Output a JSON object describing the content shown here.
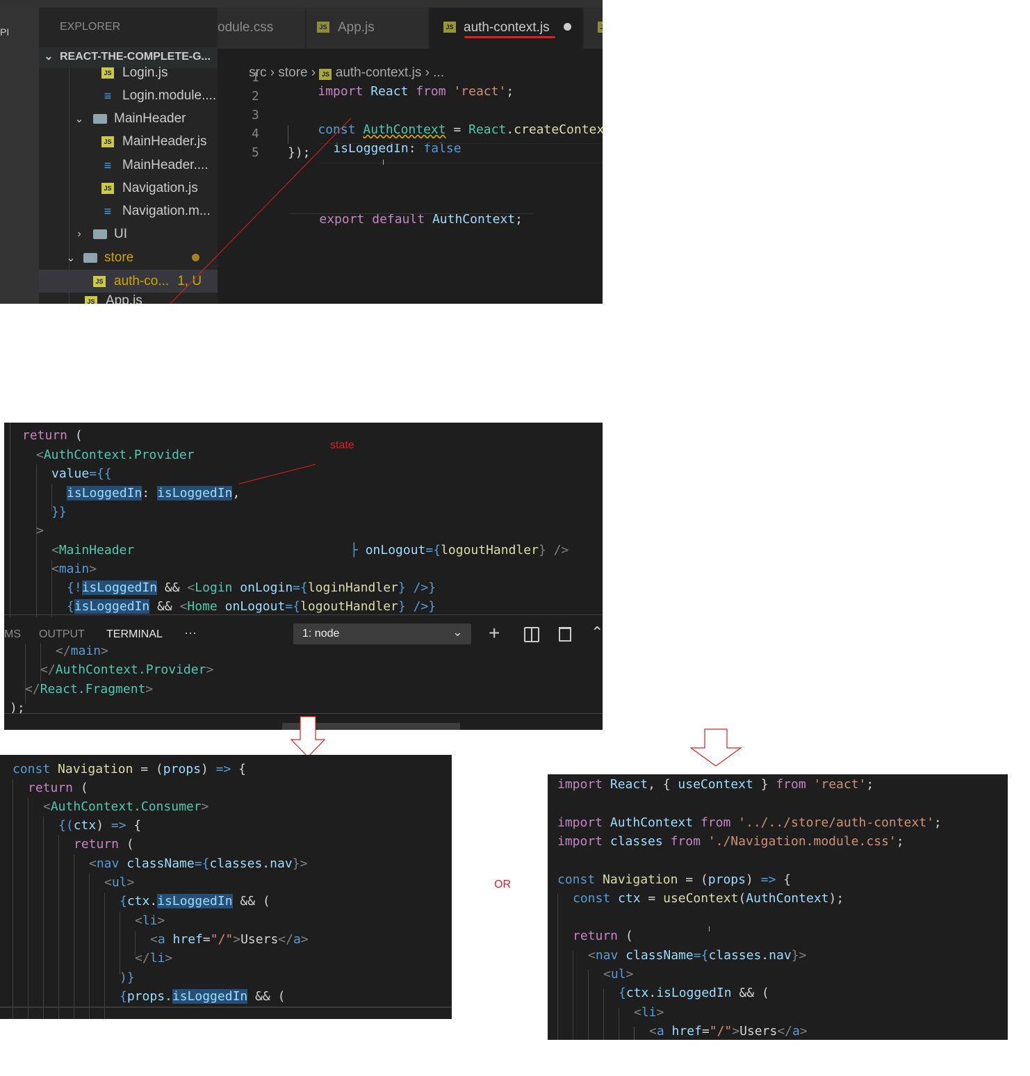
{
  "top": {
    "explorer_label": "EXPLORER",
    "left_edge_label": "PI",
    "tabs": [
      {
        "label": "odule.css"
      },
      {
        "label": "App.js",
        "icon": "JS"
      },
      {
        "label": "auth-context.js",
        "icon": "JS"
      }
    ],
    "project_name": "REACT-THE-COMPLETE-G...",
    "breadcrumb": [
      "src",
      "store",
      "auth-context.js",
      "..."
    ],
    "tree": [
      {
        "label": "Login.js",
        "type": "js"
      },
      {
        "label": "Login.module....",
        "type": "css"
      },
      {
        "label": "MainHeader",
        "type": "folder-open"
      },
      {
        "label": "MainHeader.js",
        "type": "js"
      },
      {
        "label": "MainHeader....",
        "type": "css"
      },
      {
        "label": "Navigation.js",
        "type": "js"
      },
      {
        "label": "Navigation.m...",
        "type": "css"
      },
      {
        "label": "UI",
        "type": "folder-closed"
      },
      {
        "label": "store",
        "type": "folder-open"
      },
      {
        "label": "auth-co...",
        "type": "js",
        "badge": "1, U"
      },
      {
        "label": "App.js",
        "type": "js"
      }
    ],
    "line_numbers": [
      "1",
      "2",
      "3",
      "4",
      "5"
    ],
    "code": {
      "l1": [
        "import",
        " React ",
        "from",
        " 'react'",
        ";"
      ],
      "l3": [
        "const",
        " ",
        "AuthContext",
        " = ",
        "React",
        ".",
        "createContext",
        "({"
      ],
      "l4": [
        "isLoggedIn",
        ": ",
        "false"
      ],
      "l5": "});",
      "export": [
        "export",
        " ",
        "default",
        " ",
        "AuthContext",
        ";"
      ]
    }
  },
  "mid": {
    "annotation": "state",
    "terminal_tabs": [
      "MS",
      "OUTPUT",
      "TERMINAL",
      "···"
    ],
    "terminal_select": "1: node",
    "lines": {
      "l1": [
        "return",
        " ("
      ],
      "l2": [
        "<",
        "AuthContext.Provider"
      ],
      "l3": [
        "value",
        "={{"
      ],
      "l4": [
        "isLoggedIn",
        ": ",
        "isLoggedIn",
        ","
      ],
      "l5": "}}",
      "l6": ">",
      "l7a": [
        "<",
        "MainHeader"
      ],
      "l7b": [
        "onLogout",
        "={",
        "logoutHandler",
        "} />"
      ],
      "l8": [
        "<",
        "main",
        ">"
      ],
      "l9": [
        "{!",
        "isLoggedIn",
        " && ",
        "<",
        "Login",
        " ",
        "onLogin",
        "={",
        "loginHandler",
        "} />}"
      ],
      "l10": [
        "{",
        "isLoggedIn",
        " && ",
        "<",
        "Home",
        " ",
        "onLogout",
        "={",
        "logoutHandler",
        "} />}"
      ],
      "l11": [
        "</",
        "main",
        ">"
      ],
      "l12": [
        "</",
        "AuthContext.Provider",
        ">"
      ],
      "l13": [
        "</",
        "React.Fragment",
        ">"
      ],
      "l14": ");"
    }
  },
  "left": {
    "lines": {
      "l1": [
        "const",
        " ",
        "Navigation",
        " = (",
        "props",
        ") ",
        "=>",
        " {"
      ],
      "l2": [
        "return",
        " ("
      ],
      "l3": [
        "<",
        "AuthContext.Consumer",
        ">"
      ],
      "l4": [
        "{(",
        "ctx",
        ") ",
        "=>",
        " {"
      ],
      "l5": [
        "return",
        " ("
      ],
      "l6": [
        "<",
        "nav",
        " ",
        "className",
        "={",
        "classes",
        ".",
        "nav",
        "}>"
      ],
      "l7": [
        "<",
        "ul",
        ">"
      ],
      "l8": [
        "{",
        "ctx",
        ".",
        "isLoggedIn",
        " && ("
      ],
      "l9": [
        "<",
        "li",
        ">"
      ],
      "l10": [
        "<",
        "a",
        " ",
        "href",
        "=",
        "\"/\"",
        ">",
        "Users",
        "</",
        "a",
        ">"
      ],
      "l11": [
        "</",
        "li",
        ">"
      ],
      "l12": ")}",
      "l13": [
        "{",
        "props",
        ".",
        "isLoggedIn",
        " && ("
      ]
    }
  },
  "or_label": "OR",
  "right": {
    "lines": {
      "l1": [
        "import",
        " ",
        "React",
        ", { ",
        "useContext",
        " } ",
        "from",
        " ",
        "'react'",
        ";"
      ],
      "l3": [
        "import",
        " ",
        "AuthContext",
        " ",
        "from",
        " ",
        "'../../store/auth-context'",
        ";"
      ],
      "l4": [
        "import",
        " ",
        "classes",
        " ",
        "from",
        " ",
        "'./Navigation.module.css'",
        ";"
      ],
      "l6": [
        "const",
        " ",
        "Navigation",
        " = (",
        "props",
        ") ",
        "=>",
        " {"
      ],
      "l7": [
        "const",
        " ",
        "ctx",
        " = ",
        "useContext",
        "(",
        "AuthContext",
        ");"
      ],
      "l9": [
        "return",
        " ("
      ],
      "l10": [
        "<",
        "nav",
        " ",
        "className",
        "={",
        "classes",
        ".",
        "nav",
        "}>"
      ],
      "l11": [
        "<",
        "ul",
        ">"
      ],
      "l12": [
        "{",
        "ctx",
        ".",
        "isLoggedIn",
        " && ("
      ],
      "l13": [
        "<",
        "li",
        ">"
      ],
      "l14": [
        "<",
        "a",
        " ",
        "href",
        "=",
        "\"/\"",
        ">",
        "Users",
        "</",
        "a",
        ">"
      ]
    }
  },
  "colors": {
    "editor_bg": "#1e1e1e",
    "sidebar_bg": "#252526",
    "keyword": "#569cd6",
    "control": "#c586c0",
    "string": "#ce9178",
    "function": "#dcdcaa",
    "variable": "#9cdcfe",
    "type": "#4ec9b0",
    "annotation_red": "#e02020",
    "selection": "#264f78",
    "modified_dot": "#a6821f"
  }
}
